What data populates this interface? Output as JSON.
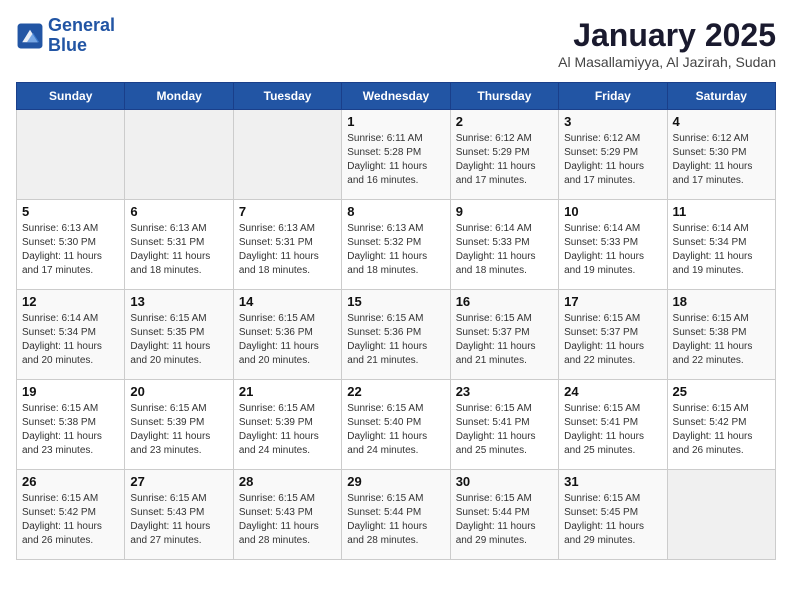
{
  "header": {
    "logo_line1": "General",
    "logo_line2": "Blue",
    "title": "January 2025",
    "subtitle": "Al Masallamiyya, Al Jazirah, Sudan"
  },
  "weekdays": [
    "Sunday",
    "Monday",
    "Tuesday",
    "Wednesday",
    "Thursday",
    "Friday",
    "Saturday"
  ],
  "weeks": [
    [
      {
        "day": "",
        "info": ""
      },
      {
        "day": "",
        "info": ""
      },
      {
        "day": "",
        "info": ""
      },
      {
        "day": "1",
        "info": "Sunrise: 6:11 AM\nSunset: 5:28 PM\nDaylight: 11 hours and 16 minutes."
      },
      {
        "day": "2",
        "info": "Sunrise: 6:12 AM\nSunset: 5:29 PM\nDaylight: 11 hours and 17 minutes."
      },
      {
        "day": "3",
        "info": "Sunrise: 6:12 AM\nSunset: 5:29 PM\nDaylight: 11 hours and 17 minutes."
      },
      {
        "day": "4",
        "info": "Sunrise: 6:12 AM\nSunset: 5:30 PM\nDaylight: 11 hours and 17 minutes."
      }
    ],
    [
      {
        "day": "5",
        "info": "Sunrise: 6:13 AM\nSunset: 5:30 PM\nDaylight: 11 hours and 17 minutes."
      },
      {
        "day": "6",
        "info": "Sunrise: 6:13 AM\nSunset: 5:31 PM\nDaylight: 11 hours and 18 minutes."
      },
      {
        "day": "7",
        "info": "Sunrise: 6:13 AM\nSunset: 5:31 PM\nDaylight: 11 hours and 18 minutes."
      },
      {
        "day": "8",
        "info": "Sunrise: 6:13 AM\nSunset: 5:32 PM\nDaylight: 11 hours and 18 minutes."
      },
      {
        "day": "9",
        "info": "Sunrise: 6:14 AM\nSunset: 5:33 PM\nDaylight: 11 hours and 18 minutes."
      },
      {
        "day": "10",
        "info": "Sunrise: 6:14 AM\nSunset: 5:33 PM\nDaylight: 11 hours and 19 minutes."
      },
      {
        "day": "11",
        "info": "Sunrise: 6:14 AM\nSunset: 5:34 PM\nDaylight: 11 hours and 19 minutes."
      }
    ],
    [
      {
        "day": "12",
        "info": "Sunrise: 6:14 AM\nSunset: 5:34 PM\nDaylight: 11 hours and 20 minutes."
      },
      {
        "day": "13",
        "info": "Sunrise: 6:15 AM\nSunset: 5:35 PM\nDaylight: 11 hours and 20 minutes."
      },
      {
        "day": "14",
        "info": "Sunrise: 6:15 AM\nSunset: 5:36 PM\nDaylight: 11 hours and 20 minutes."
      },
      {
        "day": "15",
        "info": "Sunrise: 6:15 AM\nSunset: 5:36 PM\nDaylight: 11 hours and 21 minutes."
      },
      {
        "day": "16",
        "info": "Sunrise: 6:15 AM\nSunset: 5:37 PM\nDaylight: 11 hours and 21 minutes."
      },
      {
        "day": "17",
        "info": "Sunrise: 6:15 AM\nSunset: 5:37 PM\nDaylight: 11 hours and 22 minutes."
      },
      {
        "day": "18",
        "info": "Sunrise: 6:15 AM\nSunset: 5:38 PM\nDaylight: 11 hours and 22 minutes."
      }
    ],
    [
      {
        "day": "19",
        "info": "Sunrise: 6:15 AM\nSunset: 5:38 PM\nDaylight: 11 hours and 23 minutes."
      },
      {
        "day": "20",
        "info": "Sunrise: 6:15 AM\nSunset: 5:39 PM\nDaylight: 11 hours and 23 minutes."
      },
      {
        "day": "21",
        "info": "Sunrise: 6:15 AM\nSunset: 5:39 PM\nDaylight: 11 hours and 24 minutes."
      },
      {
        "day": "22",
        "info": "Sunrise: 6:15 AM\nSunset: 5:40 PM\nDaylight: 11 hours and 24 minutes."
      },
      {
        "day": "23",
        "info": "Sunrise: 6:15 AM\nSunset: 5:41 PM\nDaylight: 11 hours and 25 minutes."
      },
      {
        "day": "24",
        "info": "Sunrise: 6:15 AM\nSunset: 5:41 PM\nDaylight: 11 hours and 25 minutes."
      },
      {
        "day": "25",
        "info": "Sunrise: 6:15 AM\nSunset: 5:42 PM\nDaylight: 11 hours and 26 minutes."
      }
    ],
    [
      {
        "day": "26",
        "info": "Sunrise: 6:15 AM\nSunset: 5:42 PM\nDaylight: 11 hours and 26 minutes."
      },
      {
        "day": "27",
        "info": "Sunrise: 6:15 AM\nSunset: 5:43 PM\nDaylight: 11 hours and 27 minutes."
      },
      {
        "day": "28",
        "info": "Sunrise: 6:15 AM\nSunset: 5:43 PM\nDaylight: 11 hours and 28 minutes."
      },
      {
        "day": "29",
        "info": "Sunrise: 6:15 AM\nSunset: 5:44 PM\nDaylight: 11 hours and 28 minutes."
      },
      {
        "day": "30",
        "info": "Sunrise: 6:15 AM\nSunset: 5:44 PM\nDaylight: 11 hours and 29 minutes."
      },
      {
        "day": "31",
        "info": "Sunrise: 6:15 AM\nSunset: 5:45 PM\nDaylight: 11 hours and 29 minutes."
      },
      {
        "day": "",
        "info": ""
      }
    ]
  ]
}
